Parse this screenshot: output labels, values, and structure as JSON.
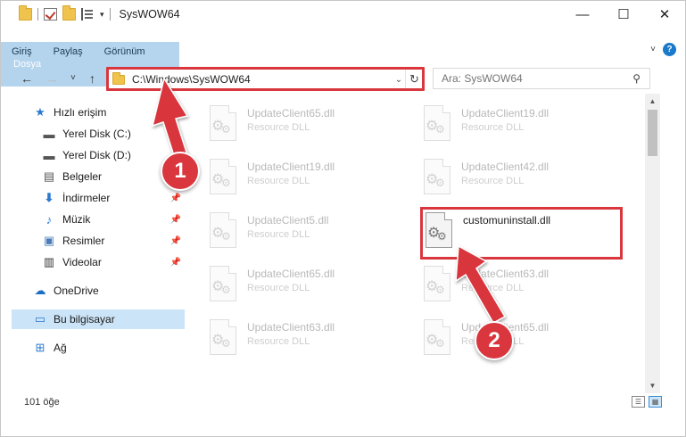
{
  "window": {
    "title": "SysWOW64",
    "controls": {
      "minimize": "—",
      "maximize": "☐",
      "close": "✕"
    }
  },
  "ribbon": {
    "tabs": [
      {
        "label": "Dosya",
        "active": true
      },
      {
        "label": "Giriş"
      },
      {
        "label": "Paylaş"
      },
      {
        "label": "Görünüm"
      }
    ],
    "expand_icon": "˅",
    "help_icon": "?"
  },
  "nav": {
    "back": "←",
    "forward": "→",
    "recent": "˅",
    "up": "↑"
  },
  "address": {
    "path": "C:\\Windows\\SysWOW64",
    "refresh": "↻",
    "dropdown": "⌄"
  },
  "search": {
    "placeholder": "Ara: SysWOW64",
    "icon": "⚲"
  },
  "sidebar": {
    "items": [
      {
        "label": "Hızlı erişim",
        "icon": "star-icon"
      },
      {
        "label": "Yerel Disk (C:)",
        "icon": "drive-icon",
        "pinned": true
      },
      {
        "label": "Yerel Disk (D:)",
        "icon": "drive-icon",
        "pinned": false
      },
      {
        "label": "Belgeler",
        "icon": "documents-icon",
        "pinned": true
      },
      {
        "label": "İndirmeler",
        "icon": "download-icon",
        "pinned": true
      },
      {
        "label": "Müzik",
        "icon": "music-icon",
        "pinned": true
      },
      {
        "label": "Resimler",
        "icon": "pictures-icon",
        "pinned": true
      },
      {
        "label": "Videolar",
        "icon": "videos-icon",
        "pinned": true
      },
      {
        "label": "OneDrive",
        "icon": "cloud-icon"
      },
      {
        "label": "Bu bilgisayar",
        "icon": "computer-icon",
        "selected": true
      },
      {
        "label": "Ağ",
        "icon": "network-icon"
      }
    ]
  },
  "files": [
    {
      "name": "UpdateClient65.dll",
      "type": "Resource DLL"
    },
    {
      "name": "UpdateClient19.dll",
      "type": "Resource DLL"
    },
    {
      "name": "UpdateClient19.dll",
      "type": "Resource DLL"
    },
    {
      "name": "UpdateClient42.dll",
      "type": "Resource DLL"
    },
    {
      "name": "UpdateClient5.dll",
      "type": "Resource DLL"
    },
    {
      "name": "customuninstall.dll",
      "type": "",
      "highlighted": true
    },
    {
      "name": "UpdateClient65.dll",
      "type": "Resource DLL"
    },
    {
      "name": "UpdateClient63.dll",
      "type": "Resource DLL"
    },
    {
      "name": "UpdateClient63.dll",
      "type": "Resource DLL"
    },
    {
      "name": "UpdateClient65.dll",
      "type": "Resource DLL"
    }
  ],
  "status": {
    "count": "101 öğe"
  },
  "annotations": {
    "step1": "1",
    "step2": "2",
    "color": "#d9363e"
  },
  "colors": {
    "accent": "#1979ca",
    "selection": "#cce4f7",
    "annotation": "#d9363e"
  }
}
